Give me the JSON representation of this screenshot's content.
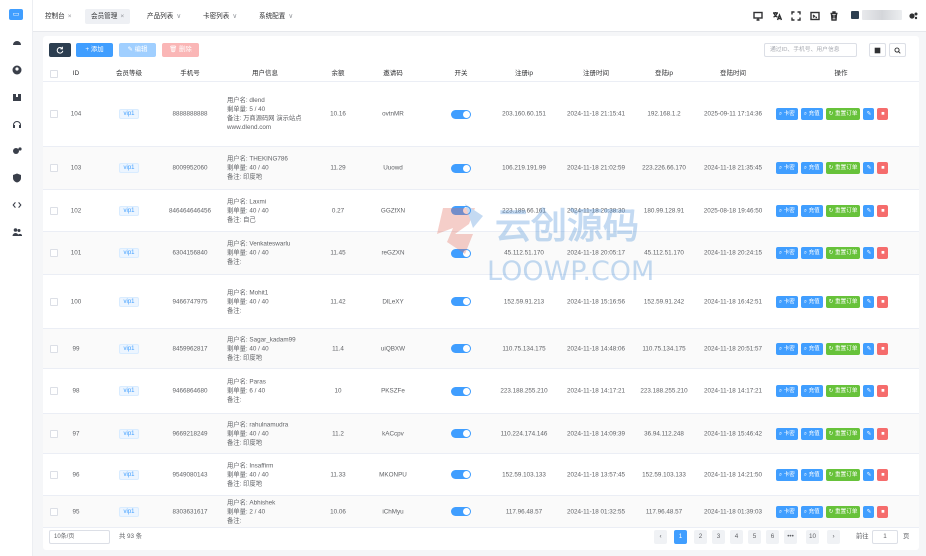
{
  "sidebar": {
    "logo": "▭",
    "icons": [
      "dashboard-icon",
      "user-circle-icon",
      "box-icon",
      "headset-icon",
      "gear-icon",
      "shield-icon",
      "code-icon",
      "users-icon"
    ]
  },
  "tabs": [
    {
      "label": "控制台",
      "close": "×"
    },
    {
      "label": "会员管理",
      "close": "×",
      "active": true
    },
    {
      "label": "产品列表",
      "close": "∨"
    },
    {
      "label": "卡密列表",
      "close": "∨"
    },
    {
      "label": "系统配置",
      "close": "∨"
    }
  ],
  "toolbar": {
    "add_label": "+ 添加",
    "edit_label": "✎ 编辑",
    "delete_label": "🗑 删除",
    "search_placeholder": "通过ID、手机号、用户信息"
  },
  "columns": [
    "ID",
    "会员等级",
    "手机号",
    "用户信息",
    "余额",
    "邀请码",
    "开关",
    "注册ip",
    "注册时间",
    "登陆ip",
    "登陆时间",
    "操作"
  ],
  "info_labels": {
    "user": "用户名:",
    "count": "剩单量:",
    "remark": "备注:"
  },
  "ops": {
    "card": "卡密",
    "recharge": "充值",
    "reset": "重置订单"
  },
  "rows": [
    {
      "id": "104",
      "level": "vip1",
      "phone": "8888888888",
      "user": "dlend",
      "count": "5 / 40",
      "remark": "万商源码网 演示站点 www.dlend.com",
      "balance": "10.16",
      "invite": "ovtnMR",
      "reg_ip": "203.160.60.151",
      "reg_time": "2024-11-18 21:15:41",
      "login_ip": "192.168.1.2",
      "login_time": "2025-09-11 17:14:36"
    },
    {
      "id": "103",
      "level": "vip1",
      "phone": "8009952060",
      "user": "THEKING786",
      "count": "40 / 40",
      "remark": "印度地",
      "balance": "11.29",
      "invite": "Uuowd",
      "reg_ip": "106.219.191.99",
      "reg_time": "2024-11-18 21:02:59",
      "login_ip": "223.226.66.170",
      "login_time": "2024-11-18 21:35:45"
    },
    {
      "id": "102",
      "level": "vip1",
      "phone": "846464646456",
      "user": "Laxmi",
      "count": "40 / 40",
      "remark": "自己",
      "balance": "0.27",
      "invite": "GGZfXN",
      "reg_ip": "223.189.66.161",
      "reg_time": "2024-11-18 20:38:30",
      "login_ip": "180.99.128.91",
      "login_time": "2025-08-18 19:46:50"
    },
    {
      "id": "101",
      "level": "vip1",
      "phone": "6304156840",
      "user": "Venkateswarlu",
      "count": "40 / 40",
      "remark": "",
      "balance": "11.45",
      "invite": "reGZXN",
      "reg_ip": "45.112.51.170",
      "reg_time": "2024-11-18 20:05:17",
      "login_ip": "45.112.51.170",
      "login_time": "2024-11-18 20:24:15"
    },
    {
      "id": "100",
      "level": "vip1",
      "phone": "9466747975",
      "user": "Mohit1",
      "count": "40 / 40",
      "remark": "",
      "balance": "11.42",
      "invite": "DlLeXY",
      "reg_ip": "152.59.91.213",
      "reg_time": "2024-11-18 15:16:56",
      "login_ip": "152.59.91.242",
      "login_time": "2024-11-18 16:42:51"
    },
    {
      "id": "99",
      "level": "vip1",
      "phone": "8459962817",
      "user": "Sagar_kadam99",
      "count": "40 / 40",
      "remark": "印度地",
      "balance": "11.4",
      "invite": "uiQBXW",
      "reg_ip": "110.75.134.175",
      "reg_time": "2024-11-18 14:48:06",
      "login_ip": "110.75.134.175",
      "login_time": "2024-11-18 20:51:57"
    },
    {
      "id": "98",
      "level": "vip1",
      "phone": "9466864680",
      "user": "Paras",
      "count": "6 / 40",
      "remark": "",
      "balance": "10",
      "invite": "PKSZFe",
      "reg_ip": "223.188.255.210",
      "reg_time": "2024-11-18 14:17:21",
      "login_ip": "223.188.255.210",
      "login_time": "2024-11-18 14:17:21"
    },
    {
      "id": "97",
      "level": "vip1",
      "phone": "9669218249",
      "user": "rahulnamudra",
      "count": "40 / 40",
      "remark": "印度地",
      "balance": "11.2",
      "invite": "kACcpv",
      "reg_ip": "110.224.174.146",
      "reg_time": "2024-11-18 14:09:39",
      "login_ip": "36.94.112.248",
      "login_time": "2024-11-18 15:46:42"
    },
    {
      "id": "96",
      "level": "vip1",
      "phone": "9549080143",
      "user": "Insaffirm",
      "count": "40 / 40",
      "remark": "印度地",
      "balance": "11.33",
      "invite": "MKONPU",
      "reg_ip": "152.59.103.133",
      "reg_time": "2024-11-18 13:57:45",
      "login_ip": "152.59.103.133",
      "login_time": "2024-11-18 14:21:50"
    },
    {
      "id": "95",
      "level": "vip1",
      "phone": "8303631617",
      "user": "Abhishek",
      "count": "2 / 40",
      "remark": "",
      "balance": "10.06",
      "invite": "iChMyu",
      "reg_ip": "117.96.48.57",
      "reg_time": "2024-11-18 01:32:55",
      "login_ip": "117.96.48.57",
      "login_time": "2024-11-18 01:39:03"
    }
  ],
  "pager": {
    "size": "10条/页",
    "total": "共 93 条",
    "pages": [
      "1",
      "2",
      "3",
      "4",
      "5",
      "6",
      "•••",
      "10"
    ],
    "current": "1",
    "goto_label": "前往",
    "goto_value": "1",
    "goto_unit": "页"
  },
  "watermark": {
    "cn": "云创源码",
    "en": "LOOWP.COM"
  },
  "colors": {
    "primary": "#409eff",
    "success": "#67c23a",
    "danger": "#f56c6c",
    "dark": "#2c3e50"
  }
}
